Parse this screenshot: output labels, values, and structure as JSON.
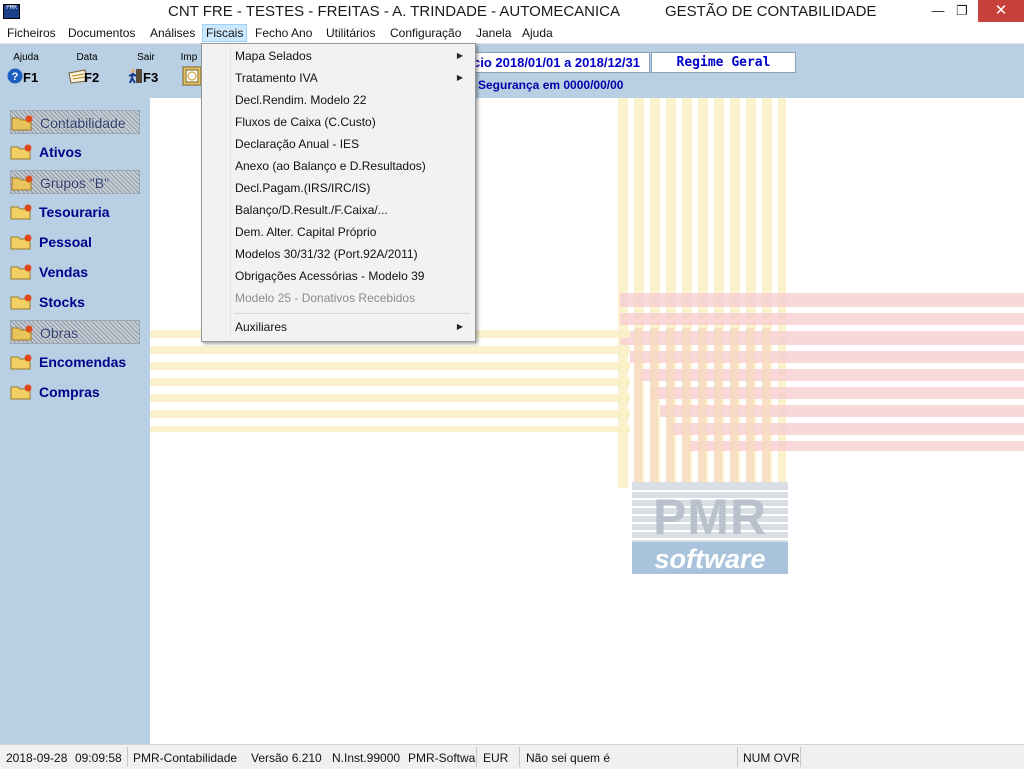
{
  "window": {
    "title": "CNT FRE - TESTES - FREITAS - A. TRINDADE - AUTOMECANICA",
    "subtitle": "GESTÃO DE CONTABILIDADE",
    "app_icon_text": "PMR",
    "buttons": {
      "minimize": "—",
      "restore": "❐",
      "close": "✕"
    }
  },
  "menubar": {
    "items": [
      "Ficheiros",
      "Documentos",
      "Análises",
      "Fiscais",
      "Fecho Ano",
      "Utilitários",
      "Configuração",
      "Janela",
      "Ajuda"
    ],
    "active": "Fiscais"
  },
  "toolbar": {
    "buttons": [
      {
        "label": "Ajuda",
        "key": "F1",
        "icon": "help-icon"
      },
      {
        "label": "Data",
        "key": "F2",
        "icon": "calendar-icon"
      },
      {
        "label": "Sair",
        "key": "F3",
        "icon": "exit-icon"
      },
      {
        "label": "Imp",
        "key": "",
        "icon": "print-icon"
      }
    ],
    "period": "cio 2018/01/01 a 2018/12/31",
    "regime": "Regime Geral",
    "security": "Segurança em  0000/00/00"
  },
  "sidebar": {
    "items": [
      {
        "label": "Contabilidade",
        "disabled": true
      },
      {
        "label": "Ativos",
        "disabled": false
      },
      {
        "label": "Grupos \"B\"",
        "disabled": true
      },
      {
        "label": "Tesouraria",
        "disabled": false
      },
      {
        "label": "Pessoal",
        "disabled": false
      },
      {
        "label": "Vendas",
        "disabled": false
      },
      {
        "label": "Stocks",
        "disabled": false
      },
      {
        "label": "Obras",
        "disabled": true
      },
      {
        "label": "Encomendas",
        "disabled": false
      },
      {
        "label": "Compras",
        "disabled": false
      }
    ]
  },
  "dropdown": {
    "items": [
      {
        "label": "Mapa Selados",
        "submenu": true,
        "disabled": false
      },
      {
        "label": "Tratamento IVA",
        "submenu": true,
        "disabled": false
      },
      {
        "label": "Decl.Rendim. Modelo 22",
        "submenu": false,
        "disabled": false
      },
      {
        "label": "Fluxos de Caixa (C.Custo)",
        "submenu": false,
        "disabled": false
      },
      {
        "label": "Declaração Anual - IES",
        "submenu": false,
        "disabled": false
      },
      {
        "label": "Anexo (ao Balanço e D.Resultados)",
        "submenu": false,
        "disabled": false
      },
      {
        "label": "Decl.Pagam.(IRS/IRC/IS)",
        "submenu": false,
        "disabled": false
      },
      {
        "label": "Balanço/D.Result./F.Caixa/...",
        "submenu": false,
        "disabled": false
      },
      {
        "label": "Dem. Alter. Capital Próprio",
        "submenu": false,
        "disabled": false
      },
      {
        "label": "Modelos 30/31/32 (Port.92A/2011)",
        "submenu": false,
        "disabled": false
      },
      {
        "label": "Obrigações Acessórias - Modelo 39",
        "submenu": false,
        "disabled": false
      },
      {
        "label": "Modelo 25 - Donativos Recebidos",
        "submenu": false,
        "disabled": true
      }
    ],
    "footer_item": {
      "label": "Auxiliares",
      "submenu": true
    }
  },
  "logo": {
    "top_text": "PMR",
    "bottom_text": "software"
  },
  "statusbar": {
    "date": "2018-09-28",
    "time": "09:09:58",
    "app": "PMR-Contabilidade",
    "version": "Versão  6.210",
    "inst": "N.Inst.99000",
    "vendor": "PMR-Softwa",
    "currency": "EUR",
    "user": "Não sei quem é",
    "keys": "NUM OVR"
  },
  "colors": {
    "panel": "#b9cfe3",
    "menu_highlight": "#cce8ff",
    "link_blue": "#0000cc",
    "close_red": "#c7403a"
  }
}
